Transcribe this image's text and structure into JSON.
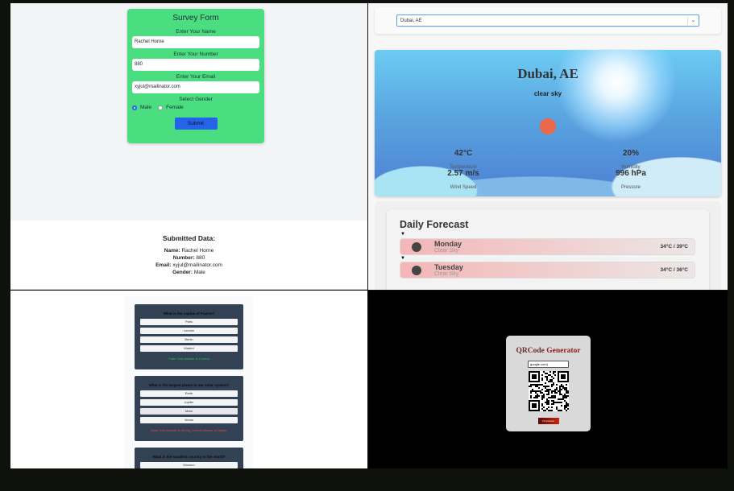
{
  "survey": {
    "title": "Survey Form",
    "name_label": "Enter Your Name",
    "name_value": "Rachel Horne",
    "number_label": "Enter Your Number",
    "number_value": "880",
    "email_label": "Enter Your Email",
    "email_value": "xyjul@mailinator.com",
    "gender_label": "Select Gender",
    "gender_options": [
      "Male",
      "Female"
    ],
    "selected_gender": "Male",
    "submit_label": "Submit"
  },
  "submitted": {
    "title": "Submitted Data:",
    "name_key": "Name:",
    "name": "Rachel Horne",
    "number_key": "Number:",
    "number": "880",
    "email_key": "Email:",
    "email": "xyjul@mailinator.com",
    "gender_key": "Gender:",
    "gender": "Male"
  },
  "weather": {
    "select_value": "Dubai, AE",
    "city": "Dubai, AE",
    "description": "clear sky",
    "stats": [
      {
        "value": "42°C",
        "label": "Temperature"
      },
      {
        "value": "20%",
        "label": "Humidity"
      },
      {
        "value": "2.57 m/s",
        "label": "Wind Speed"
      },
      {
        "value": "996 hPa",
        "label": "Pressure"
      }
    ],
    "forecast_title": "Daily Forecast",
    "toggle_glyph": "▼",
    "days": [
      {
        "name": "Monday",
        "desc": "Clear Sky",
        "temp": "34°C / 39°C"
      },
      {
        "name": "Tuesday",
        "desc": "Clear Sky",
        "temp": "34°C / 36°C"
      }
    ]
  },
  "quiz": [
    {
      "question": "What is the capital of France?",
      "options": [
        "Paris",
        "London",
        "Berlin",
        "Madrid"
      ],
      "feedback": "Paris Your Answer is Correct",
      "feedback_color": "#22c55e"
    },
    {
      "question": "What is the largest planet in our solar system?",
      "options": [
        "Earth",
        "Jupiter",
        "Mars",
        "Venus"
      ],
      "feedback": "Mars Your Answer is Wrong, correct answer is Jupiter",
      "feedback_color": "#ef4444"
    },
    {
      "question": "What is the smallest country in the world?",
      "options": [
        "Monaco"
      ]
    }
  ],
  "qr": {
    "title_a": "QRCode",
    "title_b": "Generator",
    "input_value": "google.com|",
    "download_label": "Download"
  }
}
